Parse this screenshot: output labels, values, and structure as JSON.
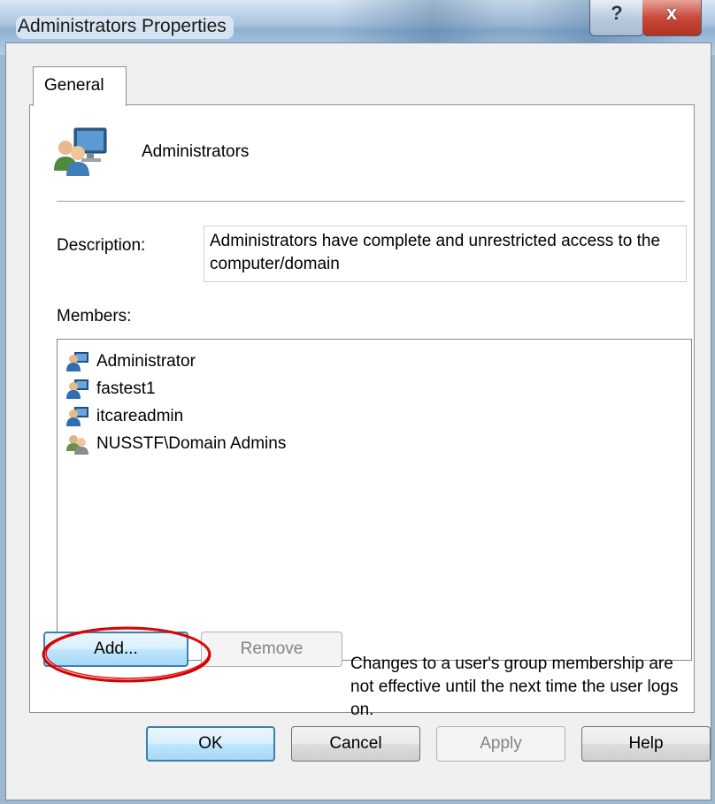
{
  "window": {
    "title": "Administrators Properties",
    "help_glyph": "?",
    "close_glyph": "x"
  },
  "tabs": [
    {
      "label": "General",
      "selected": true
    }
  ],
  "group": {
    "name": "Administrators",
    "icon": "users-group-icon"
  },
  "description": {
    "label": "Description:",
    "value": "Administrators have complete and unrestricted access to the computer/domain"
  },
  "members": {
    "label": "Members:",
    "items": [
      {
        "name": "Administrator",
        "icon": "user-icon"
      },
      {
        "name": "fastest1",
        "icon": "user-icon"
      },
      {
        "name": "itcareadmin",
        "icon": "user-icon"
      },
      {
        "name": "NUSSTF\\Domain Admins",
        "icon": "domain-group-icon"
      }
    ]
  },
  "actions": {
    "add_label": "Add...",
    "remove_label": "Remove"
  },
  "notice": "Changes to a user's group membership are not effective until the next time the user logs on.",
  "dialog_buttons": {
    "ok": "OK",
    "cancel": "Cancel",
    "apply": "Apply",
    "help": "Help"
  },
  "colors": {
    "highlight_ring": "#d40000",
    "default_button_border": "#3c7fb1",
    "disabled_text": "#838383"
  }
}
